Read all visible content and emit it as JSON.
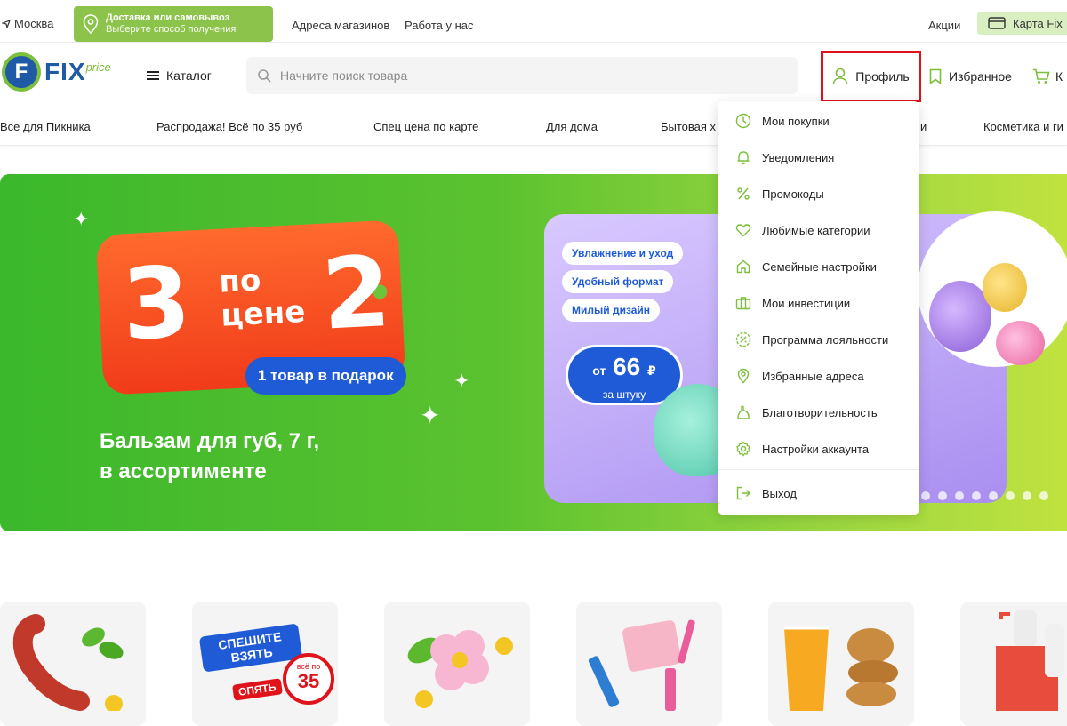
{
  "topbar": {
    "city": "Москва",
    "delivery_title": "Доставка или самовывоз",
    "delivery_subtitle": "Выберите способ получения",
    "links": [
      "Адреса магазинов",
      "Работа у нас"
    ],
    "promo_link": "Акции",
    "card_button": "Карта Fix"
  },
  "header": {
    "logo_text": "FIX",
    "logo_letter": "F",
    "logo_sub": "price",
    "catalog_label": "Каталог",
    "search_placeholder": "Начните поиск товара",
    "profile_label": "Профиль",
    "favorites_label": "Избранное",
    "cart_label": "К"
  },
  "categories": [
    "Все для Пикника",
    "Распродажа! Всё по 35 руб",
    "Спец цена по карте",
    "Для дома",
    "Бытовая х",
    "и",
    "Косметика и ги"
  ],
  "banner": {
    "tag_number_left": "3",
    "tag_po": "по",
    "tag_cene": "цене",
    "tag_number_right": "2",
    "gift_label": "1 товар в подарок",
    "product_line1": "Бальзам для губ, 7 г,",
    "product_line2": "в ассортименте",
    "features": [
      "Увлажнение и уход",
      "Удобный формат",
      "Милый дизайн"
    ],
    "price_prefix": "от",
    "price_value": "66",
    "price_currency": "₽",
    "price_unit": "за штуку"
  },
  "profile_menu": {
    "items": [
      {
        "label": "Мои покупки",
        "icon": "clock-icon"
      },
      {
        "label": "Уведомления",
        "icon": "bell-icon"
      },
      {
        "label": "Промокоды",
        "icon": "percent-icon"
      },
      {
        "label": "Любимые категории",
        "icon": "heart-icon"
      },
      {
        "label": "Семейные настройки",
        "icon": "home-icon"
      },
      {
        "label": "Мои инвестиции",
        "icon": "briefcase-icon"
      },
      {
        "label": "Программа лояльности",
        "icon": "discount-badge-icon"
      },
      {
        "label": "Избранные адреса",
        "icon": "map-pin-icon"
      },
      {
        "label": "Благотворительность",
        "icon": "charity-hand-icon"
      },
      {
        "label": "Настройки аккаунта",
        "icon": "gear-icon"
      }
    ],
    "logout": {
      "label": "Выход",
      "icon": "logout-icon"
    }
  },
  "tiles": {
    "promo_line1": "СПЕШИТЕ",
    "promo_line2": "ВЗЯТЬ",
    "promo_line3": "ОПЯТЬ",
    "promo_all": "всё по",
    "promo_price": "35"
  },
  "colors": {
    "brand_green": "#8cc34a",
    "brand_blue": "#1f5aa6",
    "highlight_red": "#e0121a",
    "menu_icon_green": "#7bbf3a"
  }
}
